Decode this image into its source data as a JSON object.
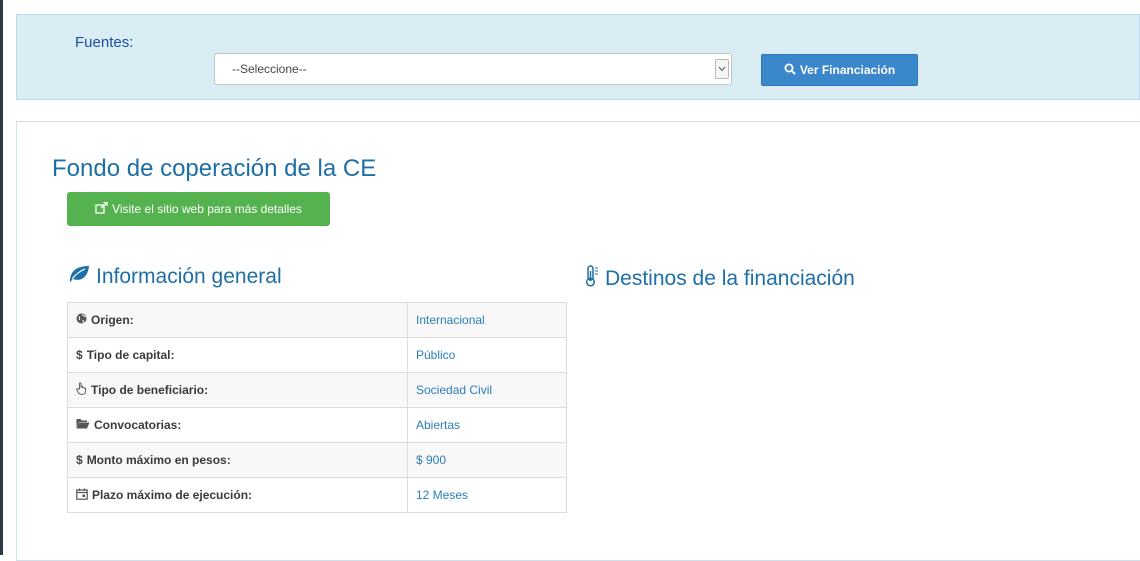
{
  "filter": {
    "label": "Fuentes:",
    "select_value": "--Seleccione--",
    "button_label": "Ver Financiación"
  },
  "fund": {
    "title": "Fondo de coperación de la CE",
    "visit_button": "Visite el sitio web para más detalles"
  },
  "info": {
    "title": "Información general",
    "rows": [
      {
        "icon": "globe-icon",
        "label": "Origen:",
        "value": "Internacional"
      },
      {
        "icon": "dollar-icon",
        "label": "Tipo de capital:",
        "value": "Público"
      },
      {
        "icon": "hand-pointer-icon",
        "label": "Tipo de beneficiario:",
        "value": "Sociedad Civil"
      },
      {
        "icon": "folder-open-icon",
        "label": "Convocatorias:",
        "value": "Abiertas"
      },
      {
        "icon": "dollar-icon",
        "label": "Monto máximo en pesos:",
        "value": "$ 900"
      },
      {
        "icon": "calendar-icon",
        "label": "Plazo máximo de ejecución:",
        "value": "12 Meses"
      }
    ]
  },
  "destinations": {
    "title": "Destinos de la financiación"
  },
  "colors": {
    "panel_bg": "#daecf4",
    "primary_button": "#3a87cb",
    "success_button": "#54b34f",
    "title_blue": "#1e6fa6",
    "value_blue": "#2a7fb5"
  }
}
